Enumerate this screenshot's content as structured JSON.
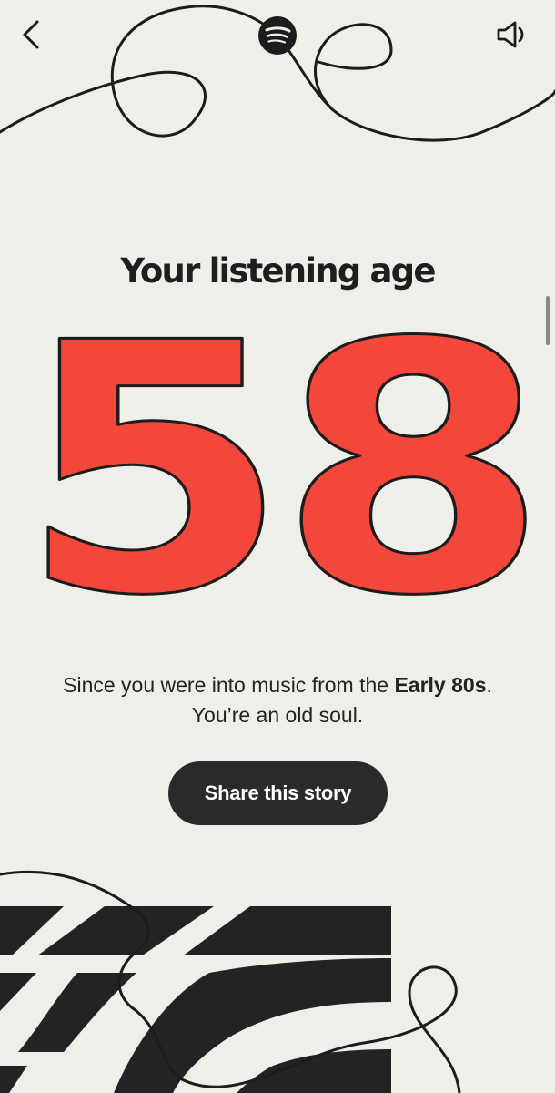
{
  "header": {
    "back_icon": "chevron-left-icon",
    "logo_icon": "spotify-logo-icon",
    "sound_icon": "speaker-icon"
  },
  "story": {
    "title": "Your listening age",
    "age": "58",
    "description_prefix": "Since you were into music from the ",
    "description_highlight": "Early 80s",
    "description_suffix": ".",
    "description_line2": "You’re an old soul."
  },
  "actions": {
    "share_label": "Share this story"
  },
  "colors": {
    "background": "#efefea",
    "accent": "#f4473b",
    "ink": "#222222"
  }
}
